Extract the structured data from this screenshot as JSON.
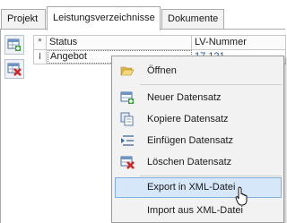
{
  "tabs": [
    {
      "label": "Projekt",
      "active": false
    },
    {
      "label": "Leistungsverzeichnisse",
      "active": true
    },
    {
      "label": "Dokumente",
      "active": false
    }
  ],
  "toolbar": {
    "buttons": [
      {
        "icon": "grid-add-icon"
      },
      {
        "icon": "grid-delete-icon"
      }
    ]
  },
  "grid": {
    "indicator_header": "*",
    "columns": [
      "Status",
      "LV-Nummer"
    ],
    "rows": [
      {
        "indicator": "I",
        "status": "Angebot",
        "lv_nummer": "17.121"
      }
    ]
  },
  "context_menu": {
    "items": [
      {
        "label": "Öffnen",
        "icon": "folder-open-icon",
        "hover": false
      },
      {
        "label": "Neuer Datensatz",
        "icon": "new-record-icon",
        "hover": false
      },
      {
        "label": "Kopiere Datensatz",
        "icon": "copy-record-icon",
        "hover": false
      },
      {
        "label": "Einfügen Datensatz",
        "icon": "insert-record-icon",
        "hover": false
      },
      {
        "label": "Löschen Datensatz",
        "icon": "delete-record-icon",
        "hover": false
      },
      {
        "label": "Export in XML-Datei",
        "icon": "",
        "hover": true
      },
      {
        "label": "Import aus XML-Datei",
        "icon": "",
        "hover": false
      }
    ]
  },
  "colors": {
    "menu_background": "#f2f2f2",
    "menu_hover": "#d5e7f8",
    "menu_hover_border": "#7fb0e0",
    "accent_blue": "#1f4f9a"
  }
}
